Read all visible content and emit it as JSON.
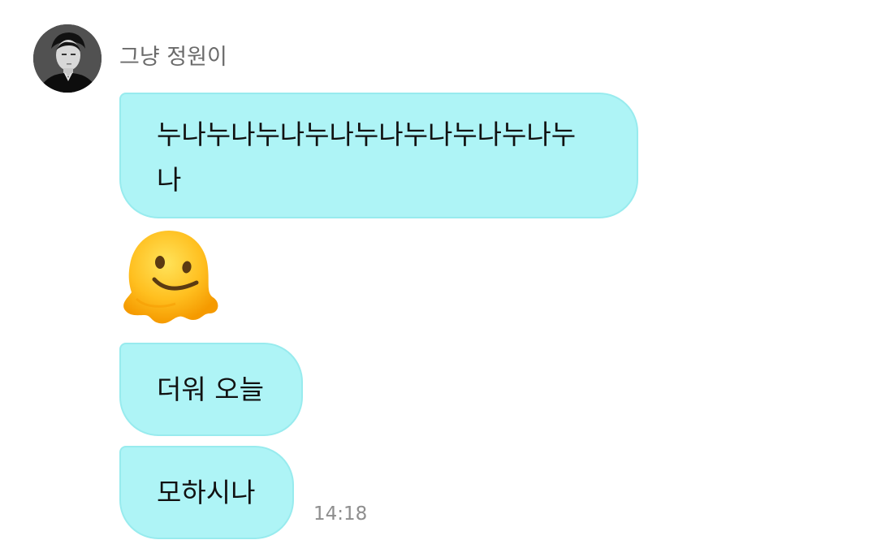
{
  "sender": {
    "name": "그냥 정원이"
  },
  "messages": [
    {
      "text": "누나누나누나누나누나누나누나누나누나"
    },
    {
      "emoji": "melting-face-emoji"
    },
    {
      "text": "더워 오늘"
    },
    {
      "text": "모하시나"
    }
  ],
  "timestamp": "14:18",
  "colors": {
    "bubble": "#aef4f6",
    "bubble_border": "#98ebee",
    "name_text": "#6b6b6b",
    "timestamp_text": "#8e8e8e"
  }
}
